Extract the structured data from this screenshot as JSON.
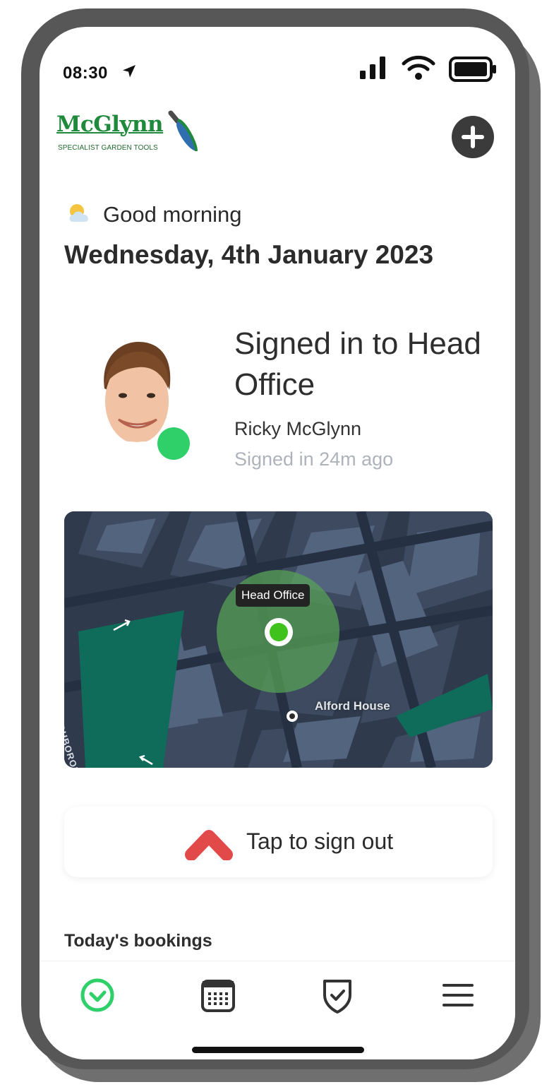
{
  "status_bar": {
    "time": "08:30",
    "icons": [
      "location-arrow-icon",
      "signal-icon",
      "wifi-icon",
      "battery-icon"
    ]
  },
  "header": {
    "logo_name": "McGlynn",
    "logo_tagline": "SPECIALIST GARDEN TOOLS",
    "add_icon": "plus-icon"
  },
  "greeting": {
    "weather_icon": "partly-cloudy-icon",
    "text": "Good morning",
    "date": "Wednesday, 4th January 2023"
  },
  "presence": {
    "title": "Signed in to Head Office",
    "user_name": "Ricky McGlynn",
    "signed_in_ago": "Signed in 24m ago",
    "status_color": "#2fd06a"
  },
  "map": {
    "location_label": "Head Office",
    "poi_label": "Alford House",
    "road_label": "LOUGHBOROUGH"
  },
  "sign_out": {
    "label": "Tap to sign out",
    "accent_color": "#e24a4a"
  },
  "bookings": {
    "title": "Today's bookings"
  },
  "nav": {
    "tabs": [
      "check-circle-icon",
      "calendar-icon",
      "shield-check-icon",
      "menu-icon"
    ],
    "active_color": "#2fd06a"
  }
}
